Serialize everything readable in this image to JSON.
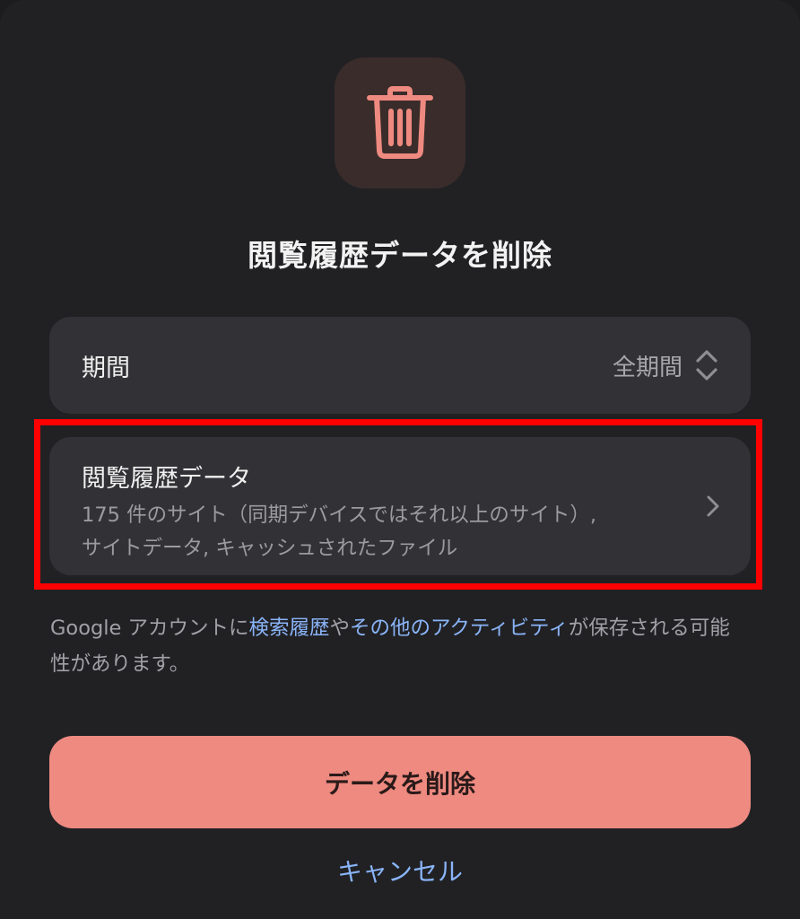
{
  "dialog": {
    "icon": "trash-icon",
    "title": "閲覧履歴データを削除"
  },
  "period": {
    "label": "期間",
    "value": "全期間"
  },
  "history": {
    "title": "閲覧履歴データ",
    "desc_line1": "175 件のサイト（同期デバイスではそれ以上のサイト）,",
    "desc_line2": "サイトデータ, キャッシュされたファイル"
  },
  "notice": {
    "prefix": "Google アカウントに",
    "link1": "検索履歴",
    "middle": "や",
    "link2": "その他のアクティビティ",
    "suffix": "が保存される可能性があります。"
  },
  "buttons": {
    "delete": "データを削除",
    "cancel": "キャンセル"
  },
  "colors": {
    "accent": "#ee8a80",
    "link": "#8ab4f8",
    "highlight": "#ff0000"
  }
}
